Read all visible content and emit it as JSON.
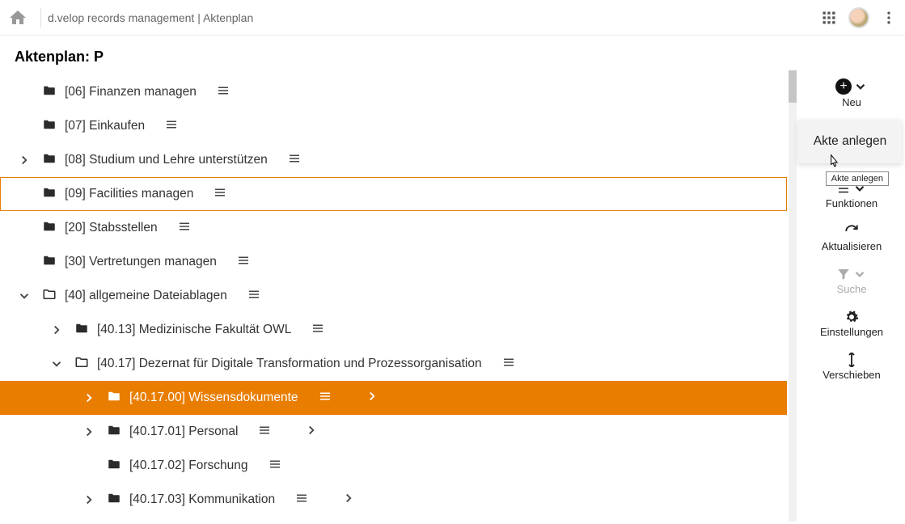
{
  "header": {
    "breadcrumb": "d.velop records management | Aktenplan"
  },
  "page": {
    "title": "Aktenplan: P"
  },
  "tree": [
    {
      "id": "06",
      "label": "[06] Finanzen managen",
      "indent": 1,
      "exp": "",
      "folder": "solid",
      "menu": true,
      "chev": false
    },
    {
      "id": "07",
      "label": "[07] Einkaufen",
      "indent": 1,
      "exp": "",
      "folder": "solid",
      "menu": true,
      "chev": false
    },
    {
      "id": "08",
      "label": "[08] Studium und Lehre unterstützen",
      "indent": 1,
      "exp": "right",
      "folder": "solid",
      "menu": true,
      "chev": false
    },
    {
      "id": "09",
      "label": "[09] Facilities managen",
      "indent": 1,
      "exp": "",
      "folder": "solid",
      "menu": true,
      "chev": false,
      "highlight": true
    },
    {
      "id": "20",
      "label": "[20] Stabsstellen",
      "indent": 1,
      "exp": "",
      "folder": "solid",
      "menu": true,
      "chev": false
    },
    {
      "id": "30",
      "label": "[30] Vertretungen managen",
      "indent": 1,
      "exp": "",
      "folder": "solid",
      "menu": true,
      "chev": false
    },
    {
      "id": "40",
      "label": "[40] allgemeine Dateiablagen",
      "indent": 1,
      "exp": "down",
      "folder": "outline",
      "menu": true,
      "chev": false
    },
    {
      "id": "4013",
      "label": "[40.13] Medizinische Fakultät OWL",
      "indent": 2,
      "exp": "right",
      "folder": "solid",
      "menu": true,
      "chev": false
    },
    {
      "id": "4017",
      "label": "[40.17] Dezernat für Digitale Transformation und Prozessorganisation",
      "indent": 2,
      "exp": "down",
      "folder": "outline",
      "menu": true,
      "chev": false
    },
    {
      "id": "401700",
      "label": "[40.17.00] Wissensdokumente",
      "indent": 3,
      "exp": "right",
      "folder": "solid",
      "menu": true,
      "chev": true,
      "selected": true
    },
    {
      "id": "401701",
      "label": "[40.17.01] Personal",
      "indent": 3,
      "exp": "right",
      "folder": "solid",
      "menu": true,
      "chev": true
    },
    {
      "id": "401702",
      "label": "[40.17.02] Forschung",
      "indent": 3,
      "exp": "",
      "folder": "solid",
      "menu": true,
      "chev": false
    },
    {
      "id": "401703",
      "label": "[40.17.03] Kommunikation",
      "indent": 3,
      "exp": "right",
      "folder": "solid",
      "menu": true,
      "chev": true
    }
  ],
  "sidebar": {
    "neu": "Neu",
    "funktionen": "Funktionen",
    "aktualisieren": "Aktualisieren",
    "suche": "Suche",
    "einstellungen": "Einstellungen",
    "verschieben": "Verschieben"
  },
  "dropdown": {
    "item1": "Akte anlegen"
  },
  "tooltip": "Akte anlegen"
}
